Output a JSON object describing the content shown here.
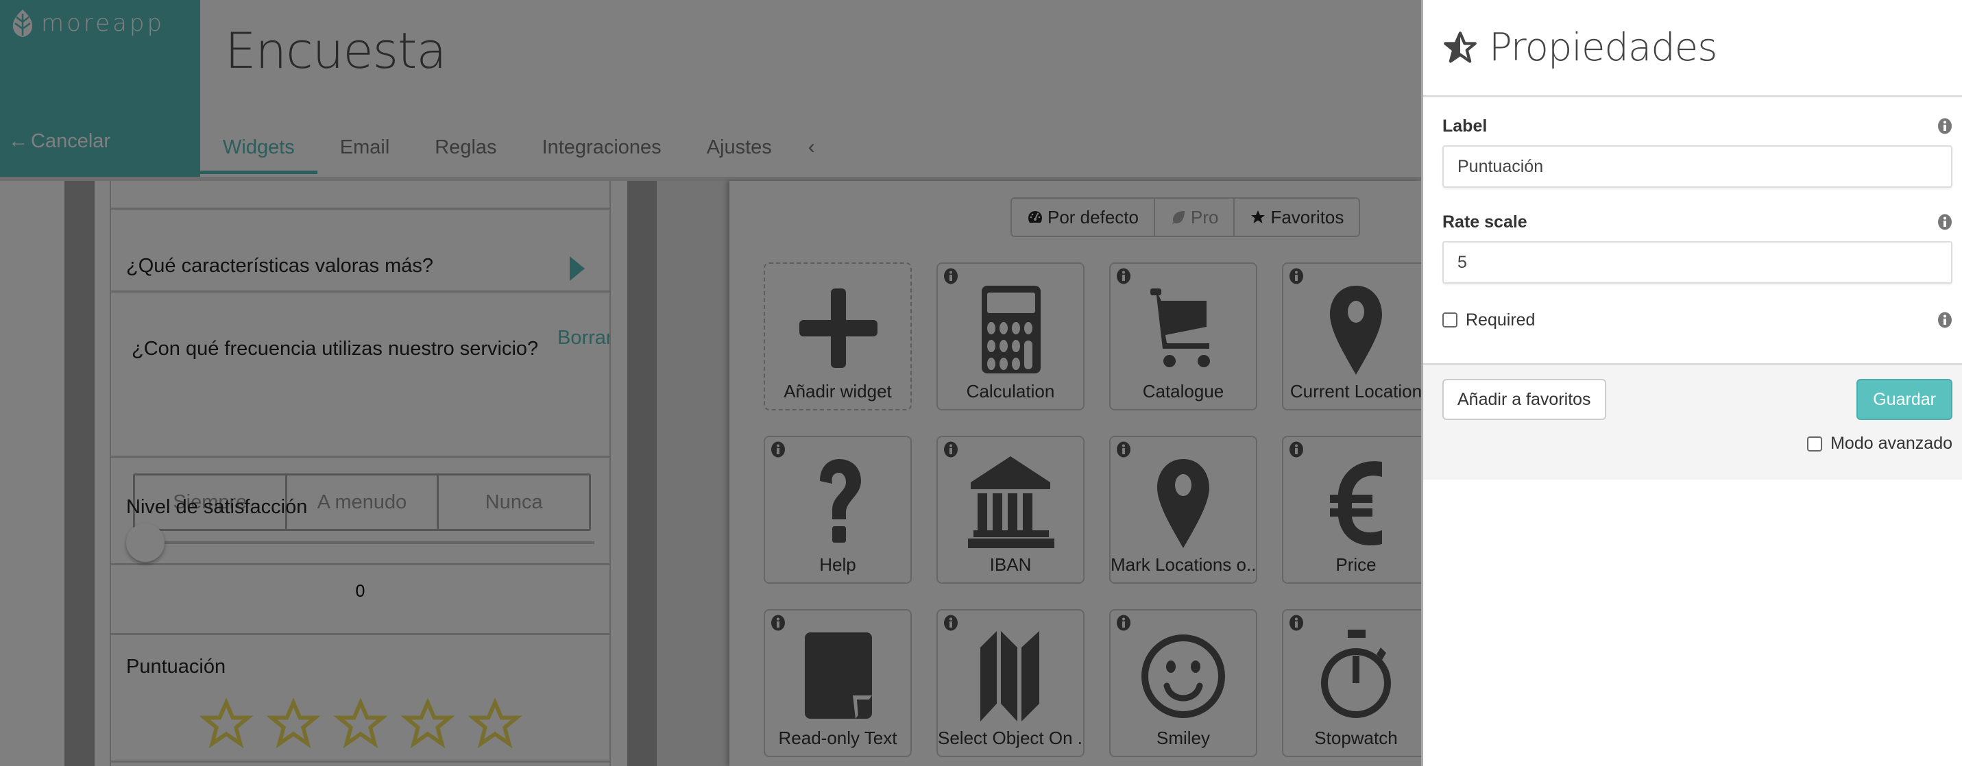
{
  "app": {
    "logo_text": "moreapp",
    "cancel_label": "Cancelar",
    "page_title": "Encuesta",
    "tabs": [
      {
        "label": "Widgets",
        "active": true
      },
      {
        "label": "Email",
        "active": false
      },
      {
        "label": "Reglas",
        "active": false
      },
      {
        "label": "Integraciones",
        "active": false
      },
      {
        "label": "Ajustes",
        "active": false
      }
    ],
    "collapse_icon": "chevron-left-icon"
  },
  "form_preview": {
    "q1_label": "¿Qué características valoras más?",
    "q2_label": "¿Con qué frecuencia utilizas nuestro servicio?",
    "q2_clear": "Borrar",
    "q2_choices": [
      "Siempre",
      "A menudo",
      "Nunca"
    ],
    "slider_label": "Nivel de satisfacción",
    "slider_value": "0",
    "rating_label": "Puntuación",
    "rating_stars": 5,
    "rating_value": 0
  },
  "palette": {
    "filters": [
      {
        "label": "Por defecto",
        "icon": "dashboard-icon"
      },
      {
        "label": "Pro",
        "icon": "leaf-icon"
      },
      {
        "label": "Favoritos",
        "icon": "star-icon"
      }
    ],
    "widgets": [
      {
        "label": "Añadir widget",
        "icon": "plus-icon"
      },
      {
        "label": "Calculation",
        "icon": "calculator-icon"
      },
      {
        "label": "Catalogue",
        "icon": "cart-icon"
      },
      {
        "label": "Current Location",
        "icon": "map-marker-icon"
      },
      {
        "label": "Help",
        "icon": "question-icon"
      },
      {
        "label": "IBAN",
        "icon": "bank-icon"
      },
      {
        "label": "Mark Locations o...",
        "icon": "map-marker-icon"
      },
      {
        "label": "Price",
        "icon": "euro-icon"
      },
      {
        "label": "Read-only Text",
        "icon": "sticky-note-icon"
      },
      {
        "label": "Select Object On ...",
        "icon": "map-icon"
      },
      {
        "label": "Smiley",
        "icon": "smiley-icon"
      },
      {
        "label": "Stopwatch",
        "icon": "stopwatch-icon"
      }
    ]
  },
  "properties": {
    "title": "Propiedades",
    "label_field": {
      "label": "Label",
      "value": "Puntuación"
    },
    "rate_field": {
      "label": "Rate scale",
      "value": "5"
    },
    "required_label": "Required",
    "required_checked": false,
    "add_favorite_label": "Añadir a favoritos",
    "save_label": "Guardar",
    "advanced_label": "Modo avanzado",
    "advanced_checked": false,
    "accent_color": "#5bc1bf"
  }
}
